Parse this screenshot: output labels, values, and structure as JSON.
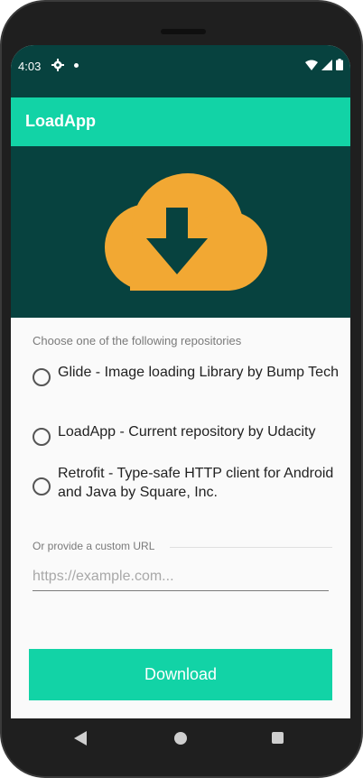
{
  "status_bar": {
    "time": "4:03",
    "icons": [
      "settings-gear-icon",
      "notification-dot-icon",
      "wifi-icon",
      "cell-signal-icon",
      "battery-icon"
    ]
  },
  "app_bar": {
    "title": "LoadApp"
  },
  "header": {
    "icon": "cloud-download-icon",
    "colors": {
      "background": "#07423f",
      "cloud": "#f2a833",
      "arrow": "#07423f"
    }
  },
  "repo_group": {
    "prompt": "Choose one of the following repositories",
    "options": [
      {
        "label": "Glide - Image loading Library by Bump Tech",
        "selected": false
      },
      {
        "label": "LoadApp - Current repository by Udacity",
        "selected": false
      },
      {
        "label": "Retrofit - Type-safe HTTP client for Android and Java by Square, Inc.",
        "selected": false
      }
    ]
  },
  "custom_url": {
    "label": "Or provide a custom URL",
    "value": "",
    "placeholder": "https://example.com..."
  },
  "download_button": {
    "label": "Download"
  },
  "nav_bar": {
    "icons": [
      "back-icon",
      "home-icon",
      "recents-icon"
    ]
  },
  "colors": {
    "primary_dark": "#07423f",
    "accent": "#12d3a6",
    "cloud": "#f2a833"
  }
}
